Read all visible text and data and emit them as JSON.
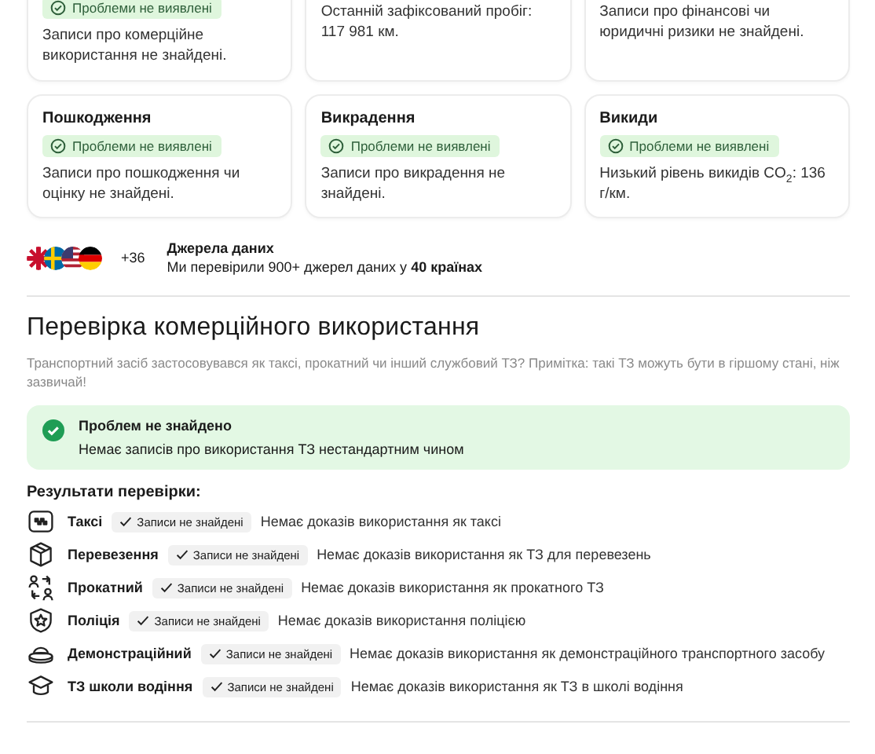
{
  "cards": [
    {
      "badge": "Проблеми не виявлені",
      "text": "Записи про комерційне використання не знайдені."
    },
    {
      "text": "Останній зафіксований пробіг: 117 981 км."
    },
    {
      "text": "Записи про фінансові чи юридичні ризики не знайдені."
    },
    {
      "title": "Пошкодження",
      "badge": "Проблеми не виявлені",
      "text": "Записи про пошкодження чи оцінку не знайдені."
    },
    {
      "title": "Викрадення",
      "badge": "Проблеми не виявлені",
      "text": "Записи про викрадення не знайдені."
    },
    {
      "title": "Викиди",
      "badge": "Проблеми не виявлені",
      "text": "Низький рівень викидів CO$_{2}$: 136 г/км."
    }
  ],
  "sources": {
    "flags": [
      {
        "kind": "uk"
      },
      {
        "kind": "se"
      },
      {
        "kind": "us"
      },
      {
        "kind": "de"
      }
    ],
    "more": "+36",
    "title": "Джерела даних",
    "text": "Ми перевірили 900+ джерел даних у **40 країнах**"
  },
  "section": {
    "title": "Перевірка комерційного використання",
    "description": "Транспортний засіб застосовувався як таксі, прокатний чи інший службовий ТЗ? Примітка: такі ТЗ можуть бути в гіршому стані, ніж зазвичай!",
    "result_box": {
      "title": "Проблем не знайдено",
      "text": "Немає записів про використання ТЗ нестандартним чином"
    },
    "results_label": "Результати перевірки:",
    "results": [
      {
        "kind": "taxi",
        "label": "Таксі",
        "status": "Записи не знайдені",
        "text": "Немає доказів використання як таксі"
      },
      {
        "kind": "delivery",
        "label": "Перевезення",
        "status": "Записи не знайдені",
        "text": "Немає доказів використання як ТЗ для перевезень"
      },
      {
        "kind": "rental",
        "label": "Прокатний",
        "status": "Записи не знайдені",
        "text": "Немає доказів використання як прокатного ТЗ"
      },
      {
        "kind": "police",
        "label": "Поліція",
        "status": "Записи не знайдені",
        "text": "Немає доказів використання поліцією"
      },
      {
        "kind": "demo",
        "label": "Демонстраційний",
        "status": "Записи не знайдені",
        "text": "Немає доказів використання як демонстраційного транспортного засобу"
      },
      {
        "kind": "school",
        "label": "ТЗ школи водіння",
        "status": "Записи не знайдені",
        "text": "Немає доказів використання як ТЗ в школі водіння"
      }
    ]
  }
}
